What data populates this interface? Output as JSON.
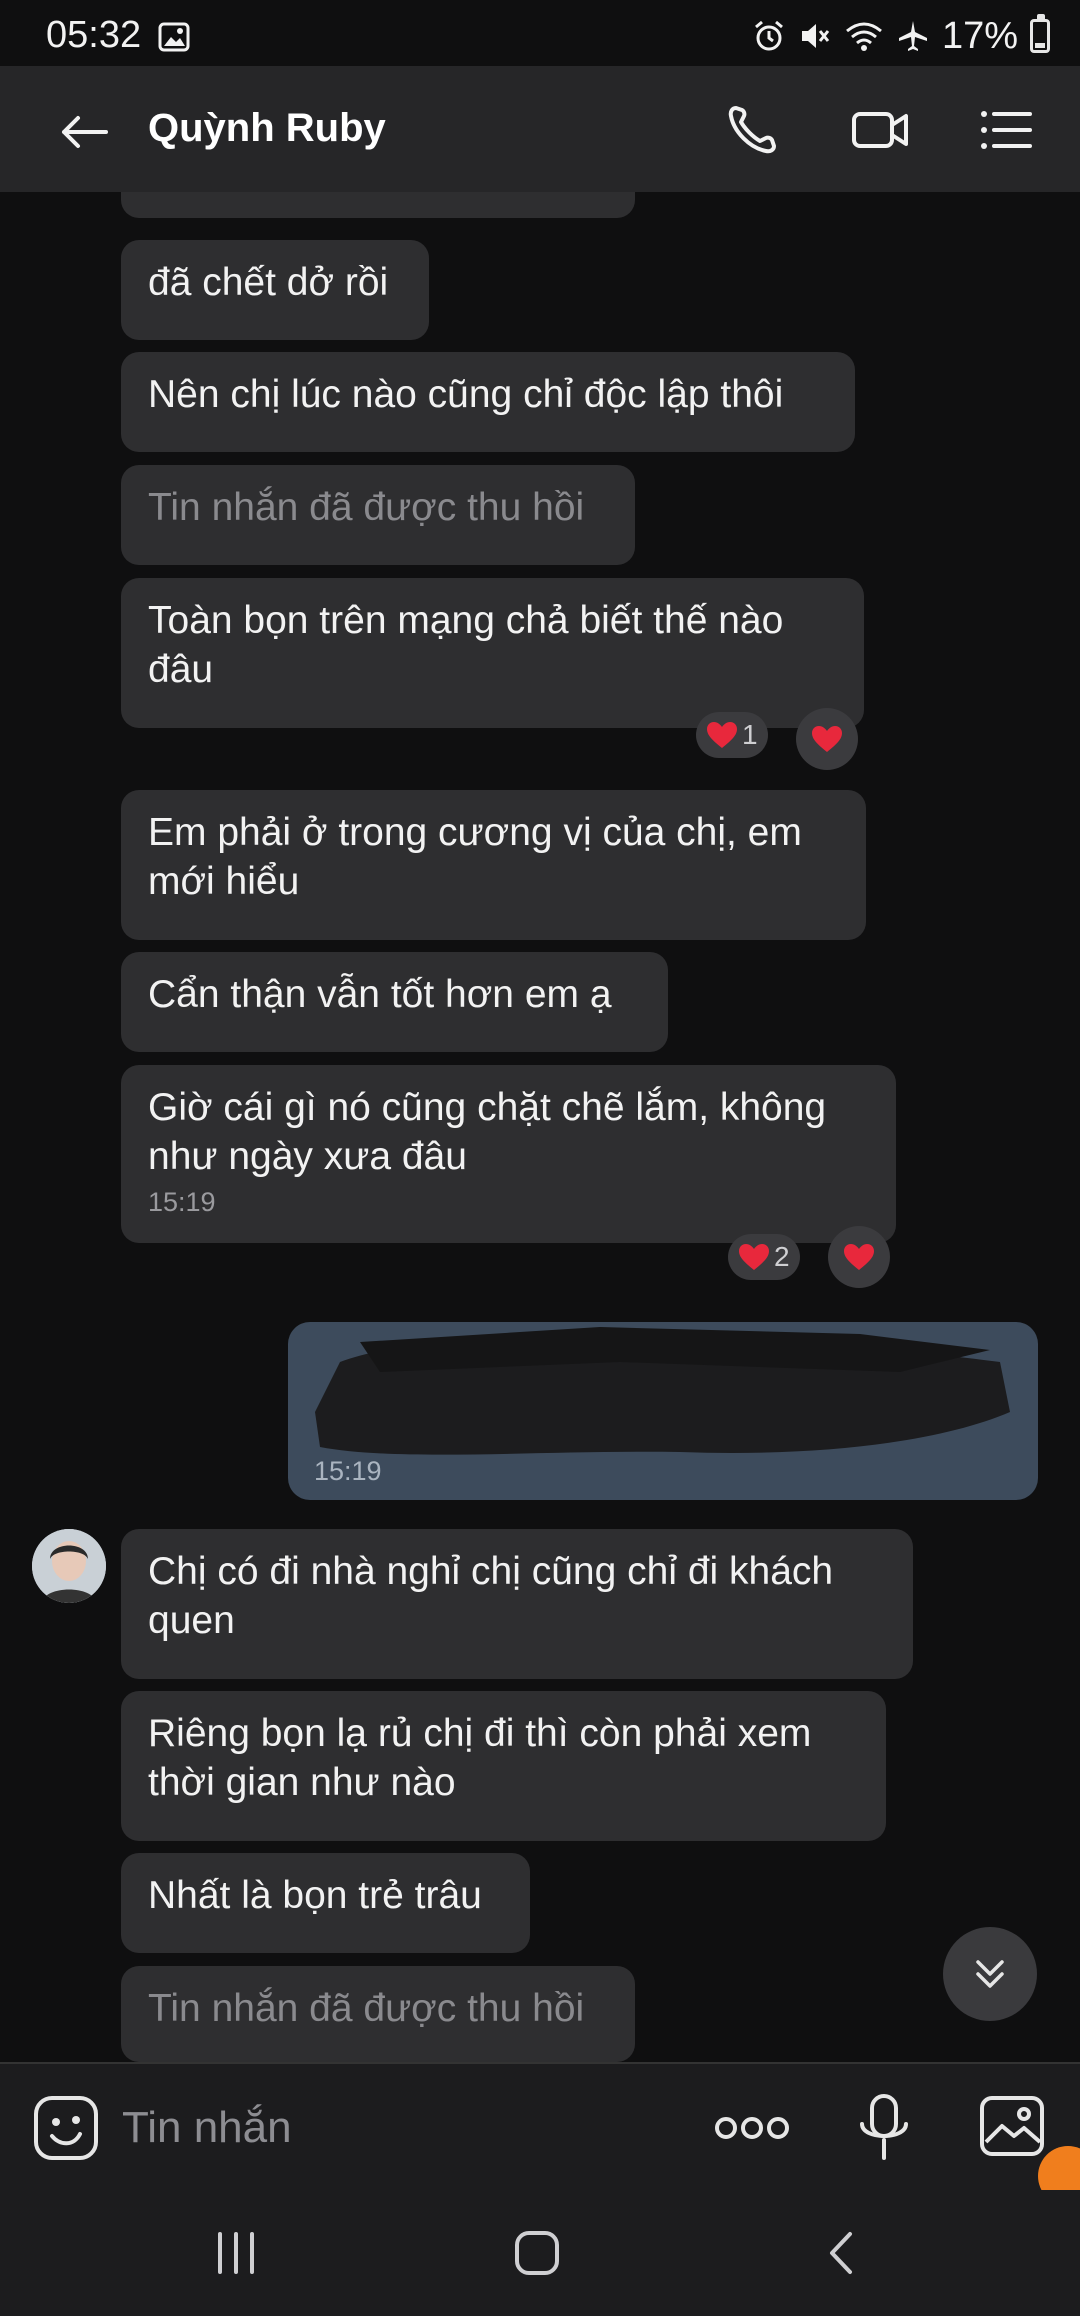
{
  "status_bar": {
    "time": "05:32",
    "battery": "17%",
    "icons": [
      "gallery-icon",
      "alarm-icon",
      "mute-icon",
      "wifi-icon",
      "airplane-icon",
      "battery-icon"
    ]
  },
  "header": {
    "contact_name": "Quỳnh Ruby",
    "icons": [
      "back-arrow-icon",
      "phone-icon",
      "video-call-icon",
      "menu-list-icon"
    ]
  },
  "messages": [
    {
      "id": "m2",
      "text": "đã chết dở rồi"
    },
    {
      "id": "m3",
      "text": "Nên chị lúc nào cũng chỉ độc lập thôi"
    },
    {
      "id": "m4",
      "text": "Tin nhắn đã được thu hồi",
      "recalled": true
    },
    {
      "id": "m5",
      "text": "Toàn bọn trên mạng chả biết thế nào đâu",
      "reaction_count": "1"
    },
    {
      "id": "m6",
      "text": "Em phải ở trong cương vị của chị, em mới hiểu"
    },
    {
      "id": "m7",
      "text": "Cẩn thận vẫn tốt  hơn em ạ"
    },
    {
      "id": "m8",
      "text": "Giờ cái gì nó cũng chặt chẽ lắm, không như ngày xưa đâu",
      "time": "15:19",
      "reaction_count": "2"
    },
    {
      "id": "m9",
      "text": "Chị có đi nhà nghỉ chị cũng chỉ đi khách quen"
    },
    {
      "id": "m10",
      "text": "Riêng bọn lạ rủ chị đi thì còn phải xem thời gian như nào"
    },
    {
      "id": "m11",
      "text": "Nhất là bọn trẻ trâu"
    },
    {
      "id": "m12",
      "text": "Tin nhắn đã được thu hồi",
      "recalled": true
    }
  ],
  "sent_message": {
    "time": "15:19"
  },
  "composer": {
    "placeholder": "Tin nhắn"
  },
  "colors": {
    "background": "#0f0f10",
    "bubble_received": "#2e2e30",
    "bubble_sent": "#3d4b5c",
    "heart": "#e8283c",
    "accent_badge": "#f07e1d"
  }
}
